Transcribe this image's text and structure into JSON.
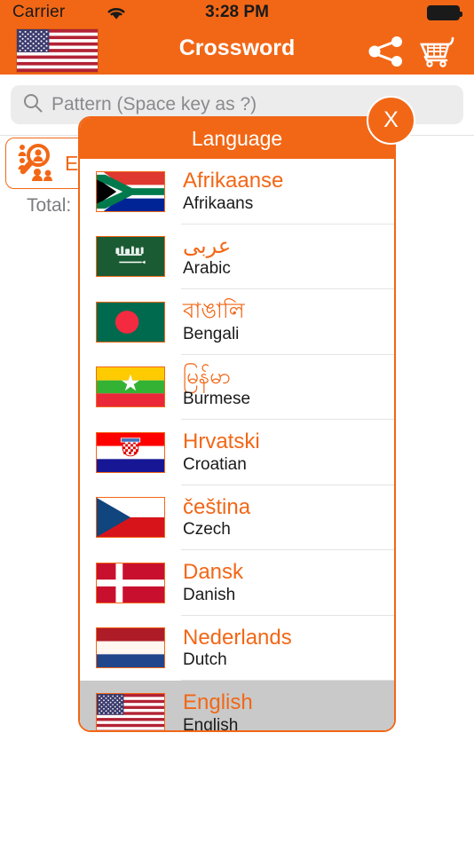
{
  "status_bar": {
    "carrier": "Carrier",
    "wifi_icon": "wifi-icon",
    "time": "3:28 PM",
    "battery_icon": "battery-full-icon"
  },
  "nav_bar": {
    "title": "Crossword",
    "flag_icon": "us-flag-icon",
    "share_icon": "share-icon",
    "cart_icon": "shopping-cart-icon"
  },
  "search": {
    "icon": "search-icon",
    "placeholder": "Pattern (Space key as ?)",
    "value": ""
  },
  "background": {
    "expert_button_label": "Expert",
    "expert_icon": "people-search-icon",
    "total_label": "Total:"
  },
  "modal": {
    "title": "Language",
    "close_label": "X",
    "close_icon": "close-icon",
    "selected_language": "English",
    "languages": [
      {
        "native": "Afrikaanse",
        "english": "Afrikaans",
        "flag": "za",
        "selected": false
      },
      {
        "native": "عربى",
        "english": "Arabic",
        "flag": "sa",
        "selected": false
      },
      {
        "native": "বাঙালি",
        "english": "Bengali",
        "flag": "bd",
        "selected": false
      },
      {
        "native": "မြန်မာ",
        "english": "Burmese",
        "flag": "mm",
        "selected": false
      },
      {
        "native": "Hrvatski",
        "english": "Croatian",
        "flag": "hr",
        "selected": false
      },
      {
        "native": "čeština",
        "english": "Czech",
        "flag": "cz",
        "selected": false
      },
      {
        "native": "Dansk",
        "english": "Danish",
        "flag": "dk",
        "selected": false
      },
      {
        "native": "Nederlands",
        "english": "Dutch",
        "flag": "nl",
        "selected": false
      },
      {
        "native": "English",
        "english": "English",
        "flag": "us",
        "selected": true
      }
    ]
  },
  "colors": {
    "accent": "#F26716",
    "nav_text": "#FFFFFF",
    "search_bg": "#ECECEC",
    "selected_row": "#C9C9C9",
    "body_text": "#1A1A1A"
  }
}
